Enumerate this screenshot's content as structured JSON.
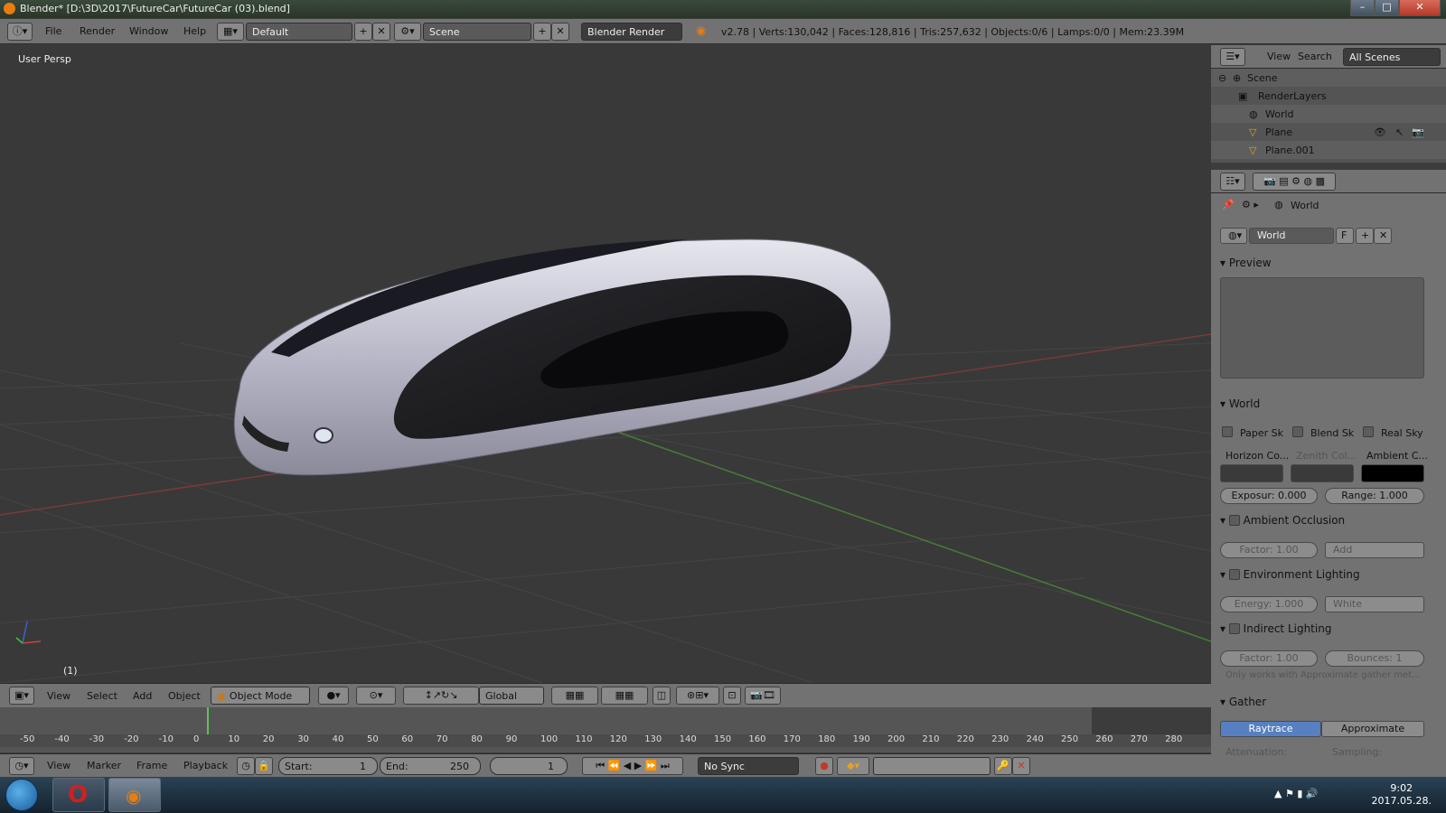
{
  "window": {
    "title": "Blender* [D:\\3D\\2017\\FutureCar\\FutureCar (03).blend]"
  },
  "info_header": {
    "menus": [
      "File",
      "Render",
      "Window",
      "Help"
    ],
    "layout": "Default",
    "scene": "Scene",
    "engine": "Blender Render",
    "stats": "v2.78 | Verts:130,042 | Faces:128,816 | Tris:257,632 | Objects:0/6 | Lamps:0/0 | Mem:23.39M"
  },
  "viewport": {
    "label": "User Persp",
    "frame": "(1)",
    "header": {
      "menus": [
        "View",
        "Select",
        "Add",
        "Object"
      ],
      "mode": "Object Mode",
      "orientation": "Global"
    }
  },
  "timeline": {
    "ticks": [
      "-50",
      "-40",
      "-30",
      "-20",
      "-10",
      "0",
      "10",
      "20",
      "30",
      "40",
      "50",
      "60",
      "70",
      "80",
      "90",
      "100",
      "110",
      "120",
      "130",
      "140",
      "150",
      "160",
      "170",
      "180",
      "190",
      "200",
      "210",
      "220",
      "230",
      "240",
      "250",
      "260",
      "270",
      "280"
    ],
    "menus": [
      "View",
      "Marker",
      "Frame",
      "Playback"
    ],
    "start_label": "Start:",
    "start": "1",
    "end_label": "End:",
    "end": "250",
    "current": "1",
    "sync": "No Sync"
  },
  "outliner": {
    "menus": [
      "View",
      "Search"
    ],
    "filter": "All Scenes",
    "items": [
      "Scene",
      "RenderLayers",
      "World",
      "Plane",
      "Plane.001"
    ]
  },
  "properties": {
    "breadcrumb": "World",
    "datablock": "World",
    "datablock_flag": "F",
    "preview_title": "Preview",
    "world_title": "World",
    "sky_options": [
      "Paper Sk",
      "Blend Sk",
      "Real Sky"
    ],
    "color_labels": [
      "Horizon Co...",
      "Zenith Col...",
      "Ambient C..."
    ],
    "exposure": "Exposur: 0.000",
    "range": "Range:  1.000",
    "ao_title": "Ambient Occlusion",
    "ao_factor_label": "Factor:",
    "ao_factor": "1.00",
    "ao_blend": "Add",
    "env_title": "Environment Lighting",
    "env_energy_label": "Energy:",
    "env_energy": "1.000",
    "env_color": "White",
    "indirect_title": "Indirect Lighting",
    "indirect_factor_label": "Factor:",
    "indirect_factor": "1.00",
    "bounces_label": "Bounces:",
    "bounces": "1",
    "indirect_note": "Only works with Approximate gather met...",
    "gather_title": "Gather",
    "gather_modes": [
      "Raytrace",
      "Approximate"
    ],
    "attenuation": "Attenuation:",
    "sampling": "Sampling:"
  },
  "taskbar": {
    "time": "9:02",
    "date": "2017.05.28."
  }
}
